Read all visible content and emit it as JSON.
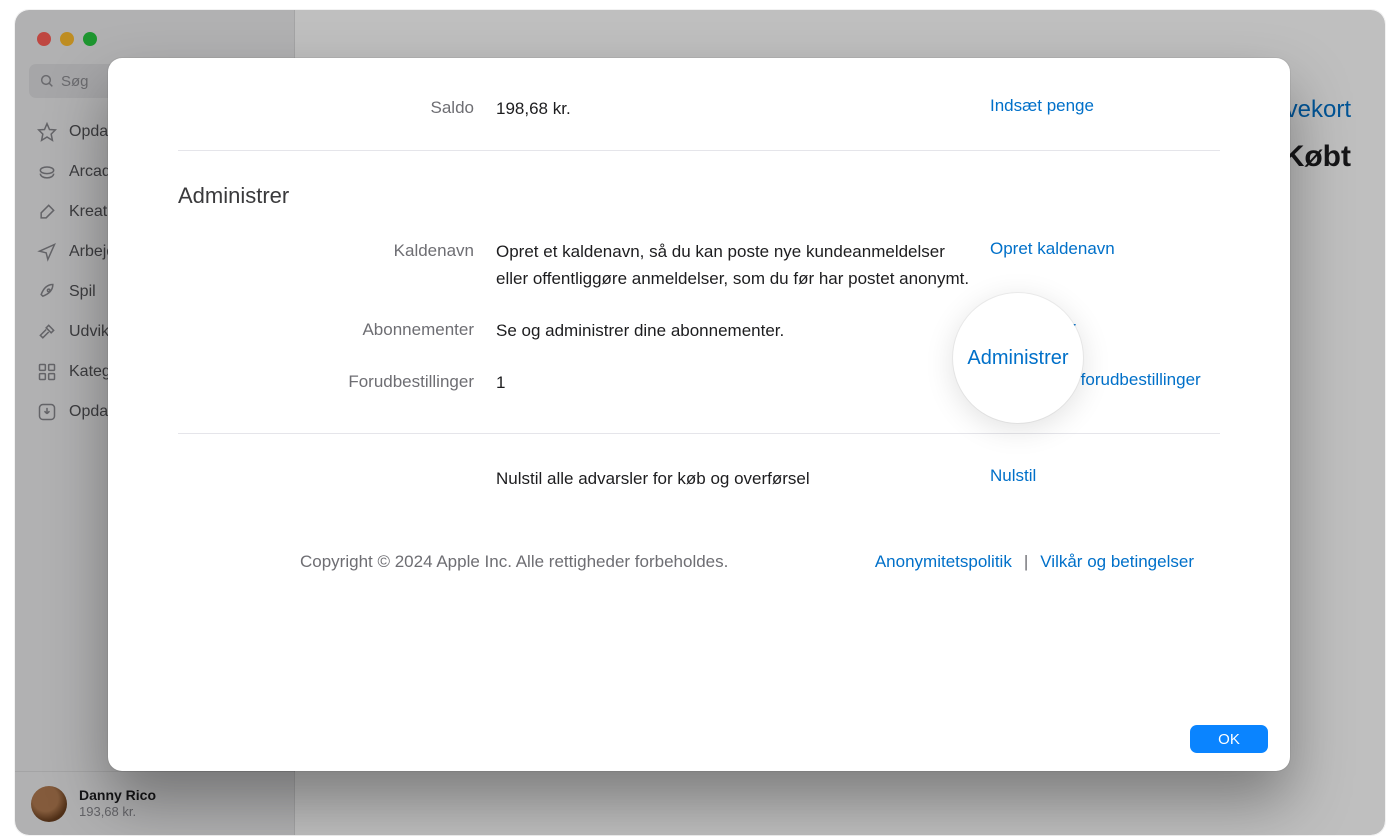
{
  "search": {
    "placeholder": "Søg"
  },
  "sidebar": {
    "items": [
      {
        "label": "Opdag"
      },
      {
        "label": "Arcade"
      },
      {
        "label": "Kreativitet"
      },
      {
        "label": "Arbejde"
      },
      {
        "label": "Spil"
      },
      {
        "label": "Udvikle"
      },
      {
        "label": "Kategorier"
      },
      {
        "label": "Opdateringer"
      }
    ]
  },
  "user": {
    "name": "Danny Rico",
    "balance": "193,68 kr."
  },
  "main_header": {
    "gift_link": "vekort",
    "purchased_heading": "Købt"
  },
  "balance_row": {
    "label": "Saldo",
    "value": "198,68 kr.",
    "action": "Indsæt penge"
  },
  "section_title": "Administrer",
  "rows": {
    "nickname": {
      "label": "Kaldenavn",
      "value": "Opret et kaldenavn, så du kan poste nye kundeanmeldelser eller offentliggøre anmeldelser, som du før har postet anonymt.",
      "action": "Opret kaldenavn"
    },
    "subscriptions": {
      "label": "Abonnementer",
      "value": "Se og administrer dine abonnementer.",
      "action": "Administrer"
    },
    "preorders": {
      "label": "Forudbestillinger",
      "value": "1",
      "action": "Administrer forudbestillinger"
    }
  },
  "reset": {
    "text": "Nulstil alle advarsler for køb og overførsel",
    "action": "Nulstil"
  },
  "footer": {
    "copyright": "Copyright © 2024 Apple Inc. Alle rettigheder forbeholdes.",
    "privacy": "Anonymitetspolitik",
    "terms": "Vilkår og betingelser",
    "separator": "|"
  },
  "ok_button": "OK",
  "magnifier_text": "Administrer"
}
